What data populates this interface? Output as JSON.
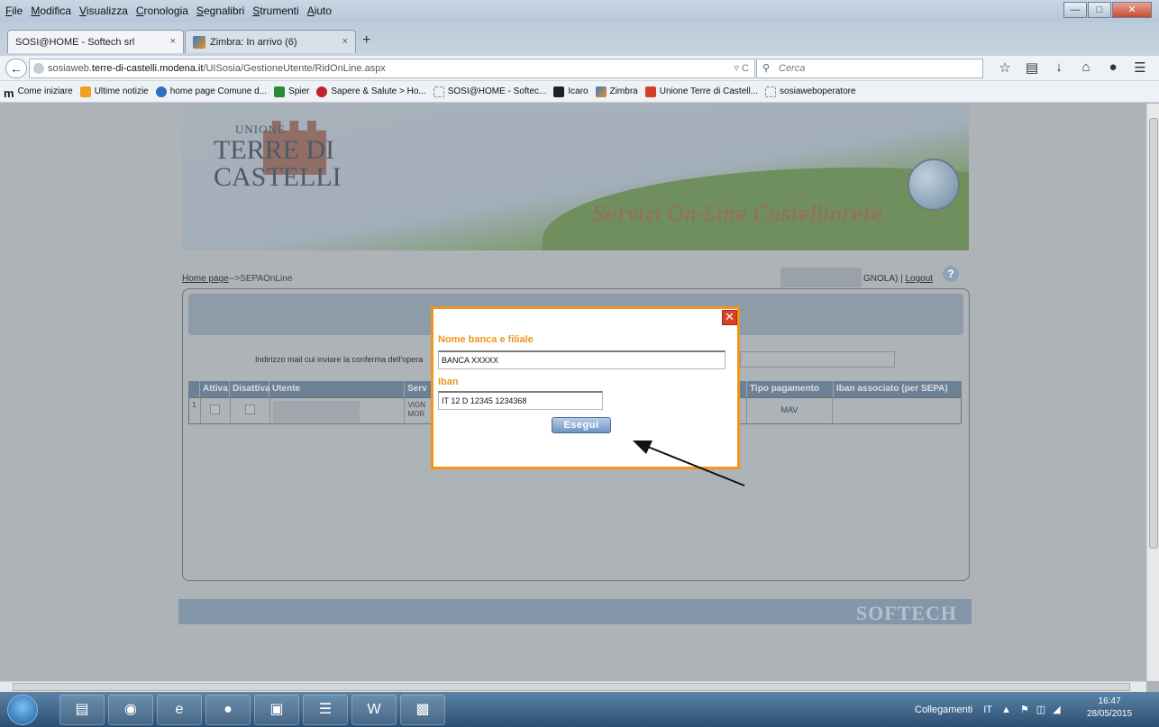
{
  "menubar": {
    "items": [
      {
        "first": "F",
        "rest": "ile"
      },
      {
        "first": "M",
        "rest": "odifica"
      },
      {
        "first": "V",
        "rest": "isualizza"
      },
      {
        "first": "C",
        "rest": "ronologia"
      },
      {
        "first": "S",
        "rest": "egnalibri"
      },
      {
        "first": "S",
        "rest": "trumenti"
      },
      {
        "first": "A",
        "rest": "iuto"
      }
    ]
  },
  "tabs": [
    {
      "label": "SOSI@HOME - Softech srl",
      "close": "×"
    },
    {
      "label": "Zimbra: In arrivo (6)",
      "close": "×"
    }
  ],
  "newtab": "+",
  "url": {
    "prefix": "sosiaweb.",
    "domain": "terre-di-castelli.modena.it",
    "path": "/UISosia/GestioneUtente/RidOnLine.aspx"
  },
  "search": {
    "placeholder": "Cerca"
  },
  "bookmarks": [
    "Come iniziare",
    "Ultime notizie",
    "home page Comune d...",
    "Spier",
    "Sapere & Salute > Ho...",
    "SOSI@HOME - Softec...",
    "Icaro",
    "Zimbra",
    "Unione Terre di Castell...",
    "sosiaweboperatore"
  ],
  "banner": {
    "logo_line1": "UNIONE",
    "logo_line2": "TERRE DI",
    "logo_line3": "CASTELLI",
    "servizi": "Servizi On-Line Castellinrete"
  },
  "breadcrumb": {
    "home": "Home page",
    "sep": "-->",
    "current": "SEPAOnLine"
  },
  "user": {
    "suffix": "GNOLA) |",
    "logout": "Logout"
  },
  "form": {
    "mail_label": "Indirizzo mail cui inviare la conferma dell'opera"
  },
  "table": {
    "headers": [
      "",
      "Attiva",
      "Disattiva",
      "Utente",
      "Serv",
      "Tipo pagamento",
      "Iban associato (per SEPA)"
    ],
    "row": {
      "num": "1",
      "servizio_line1": "VIGN",
      "servizio_line2": "MOR",
      "tipo": "MAV",
      "iban": ""
    }
  },
  "footer": {
    "brand": "SOFTECH"
  },
  "modal": {
    "close": "✕",
    "bank_label": "Nome banca e filiale",
    "bank_value": "BANCA XXXXX",
    "iban_label": "Iban",
    "iban_value": "IT 12 D 12345 1234368",
    "button": "Esegui"
  },
  "taskbar": {
    "tray_label": "Collegamenti",
    "lang": "IT",
    "time": "16:47",
    "date": "28/05/2015"
  },
  "colors": {
    "accent_orange": "#f0961c",
    "table_header": "#6d8194",
    "button_blue": "#6f93c3"
  }
}
